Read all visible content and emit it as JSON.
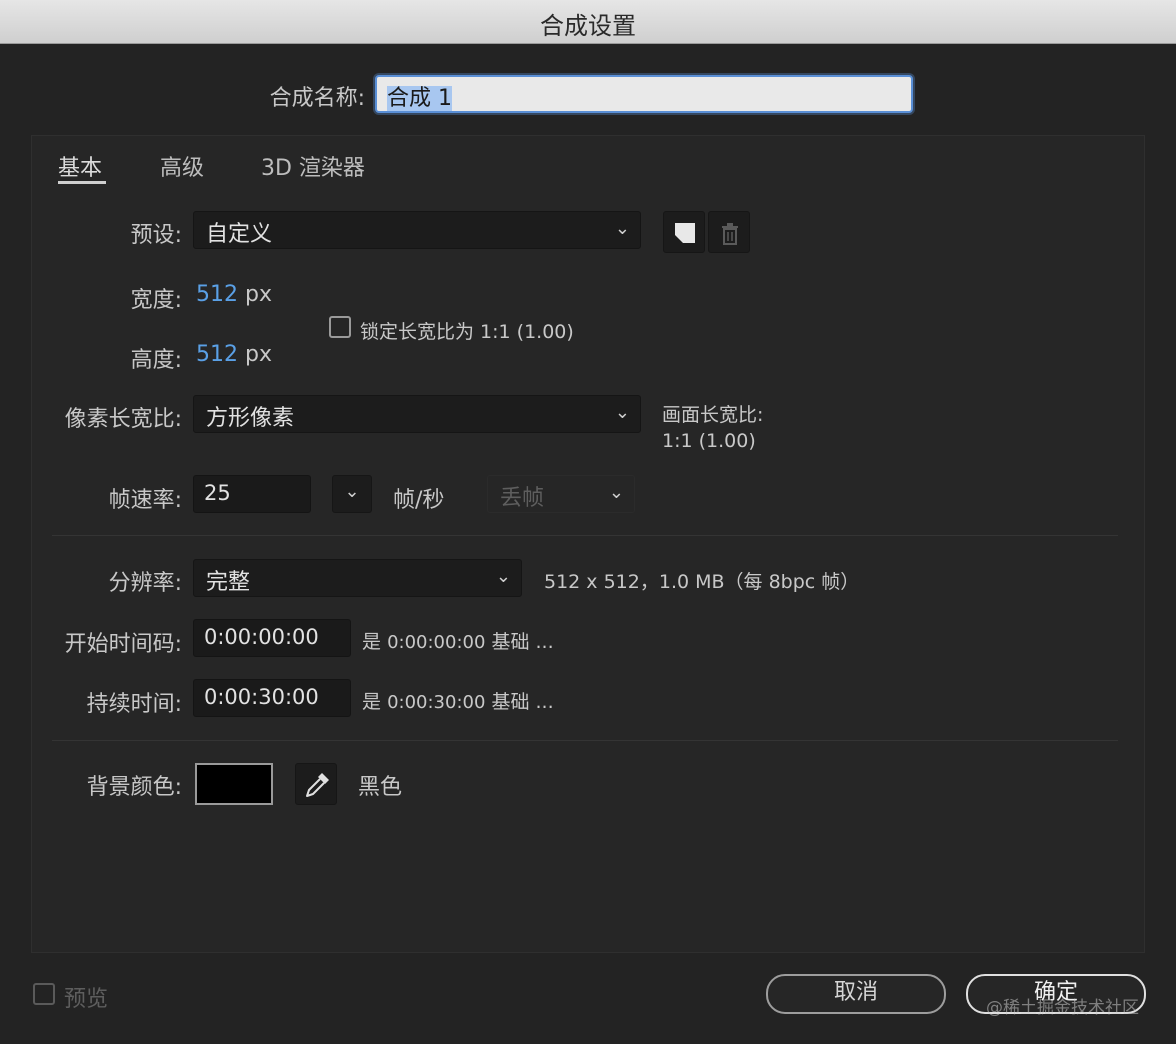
{
  "window": {
    "title": "合成设置"
  },
  "comp_name": {
    "label": "合成名称:",
    "value": "合成 1"
  },
  "tabs": [
    {
      "label": "基本",
      "active": true
    },
    {
      "label": "高级",
      "active": false
    },
    {
      "label": "3D 渲染器",
      "active": false
    }
  ],
  "preset": {
    "label": "预设:",
    "value": "自定义",
    "icons": [
      "save-preset-icon",
      "trash-icon"
    ]
  },
  "width": {
    "label": "宽度:",
    "value": "512",
    "unit": "px"
  },
  "height": {
    "label": "高度:",
    "value": "512",
    "unit": "px"
  },
  "lock_aspect": {
    "label": "锁定长宽比为 1:1 (1.00)",
    "checked": false
  },
  "pixel_aspect": {
    "label": "像素长宽比:",
    "value": "方形像素"
  },
  "frame_aspect": {
    "label": "画面长宽比:",
    "value": "1:1 (1.00)"
  },
  "frame_rate": {
    "label": "帧速率:",
    "value": "25",
    "unit": "帧/秒",
    "drop_frame": "丢帧"
  },
  "resolution": {
    "label": "分辨率:",
    "value": "完整",
    "info": "512 x 512，1.0 MB（每 8bpc 帧）"
  },
  "start_timecode": {
    "label": "开始时间码:",
    "value": "0:00:00:00",
    "info_prefix": "是",
    "info_value": "0:00:00:00",
    "info_suffix": "基础 ..."
  },
  "duration": {
    "label": "持续时间:",
    "value": "0:00:30:00",
    "info_prefix": "是",
    "info_value": "0:00:30:00",
    "info_suffix": "基础 ..."
  },
  "background": {
    "label": "背景颜色:",
    "color": "#000000",
    "color_name": "黑色"
  },
  "preview": {
    "label": "预览",
    "checked": false
  },
  "buttons": {
    "cancel": "取消",
    "ok": "确定"
  },
  "watermark": "@稀土掘金技术社区",
  "colors": {
    "accent_blue": "#5aa0e6",
    "focus_ring": "#5a8fd6",
    "dialog_bg": "#232323"
  }
}
